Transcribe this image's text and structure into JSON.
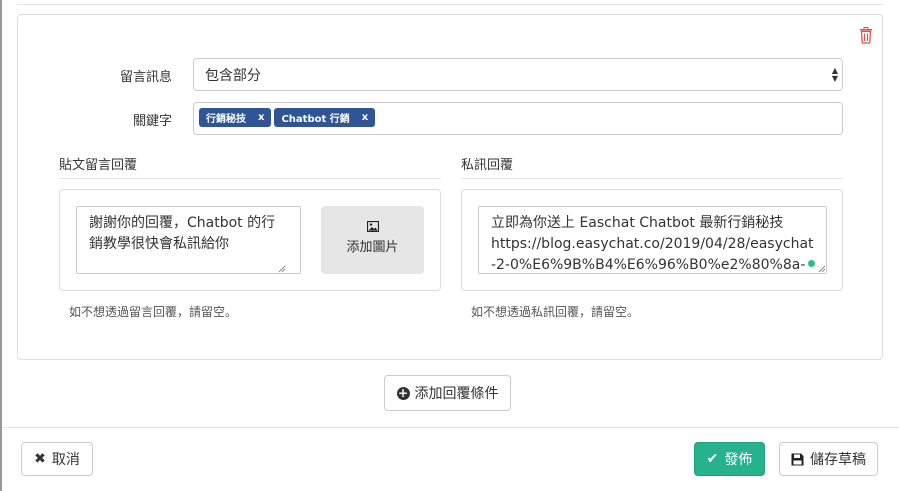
{
  "rule": {
    "message_label": "留言訊息",
    "message_select_value": "包含部分",
    "keyword_label": "關鍵字",
    "keywords": [
      {
        "label": "行銷秘技",
        "remove": "x"
      },
      {
        "label": "Chatbot 行銷",
        "remove": "x"
      }
    ],
    "comment_reply": {
      "title": "貼文留言回覆",
      "text": "謝謝你的回覆，Chatbot 的行銷教學很快會私訊給你",
      "add_image_label": "添加圖片",
      "help": "如不想透過留言回覆，請留空。"
    },
    "private_reply": {
      "title": "私訊回覆",
      "text": "立即為你送上 Easchat Chatbot 最新行銷秘技\nhttps://blog.easychat.co/2019/04/28/easychat-2-0%E6%9B%B4%E6%96%B0%e2%80%8a-",
      "help": "如不想透過私訊回覆，請留空。"
    },
    "delete_icon": "trash-icon"
  },
  "add_condition_label": "添加回覆條件",
  "footer": {
    "cancel_label": "取消",
    "publish_label": "發佈",
    "save_draft_label": "儲存草稿"
  },
  "colors": {
    "tag_bg": "#2f5596",
    "publish_bg": "#26b28d",
    "delete_red": "#d9534f"
  }
}
